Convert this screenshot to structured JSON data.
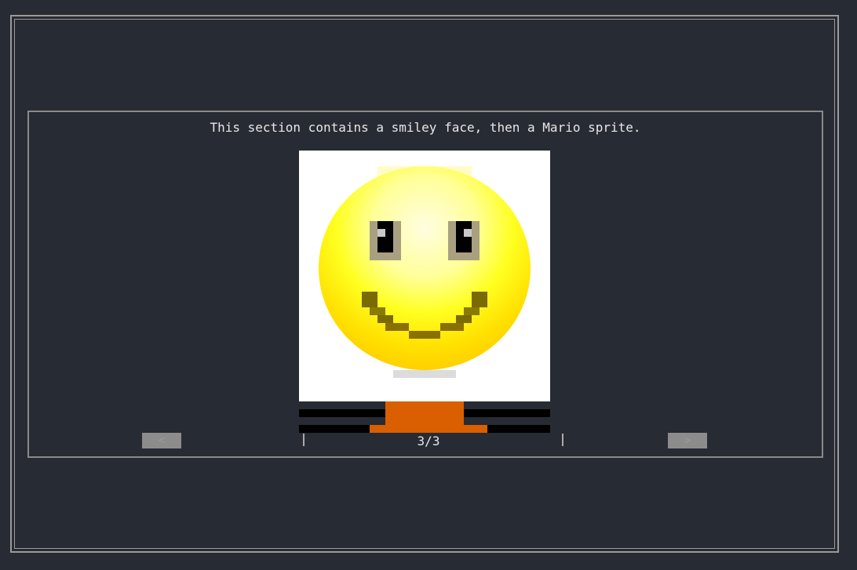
{
  "section": {
    "caption": "This section contains a smiley face, then a Mario sprite."
  },
  "images": {
    "current": "smiley-face",
    "next": "mario-sprite"
  },
  "pager": {
    "prev_label": "<",
    "next_label": ">",
    "counter": "3/3"
  },
  "colors": {
    "background": "#272b33",
    "border": "#9a9a9a",
    "button": "#8c8c8c",
    "mario_orange": "#d95f00",
    "smiley_yellow": "#ffe000"
  }
}
